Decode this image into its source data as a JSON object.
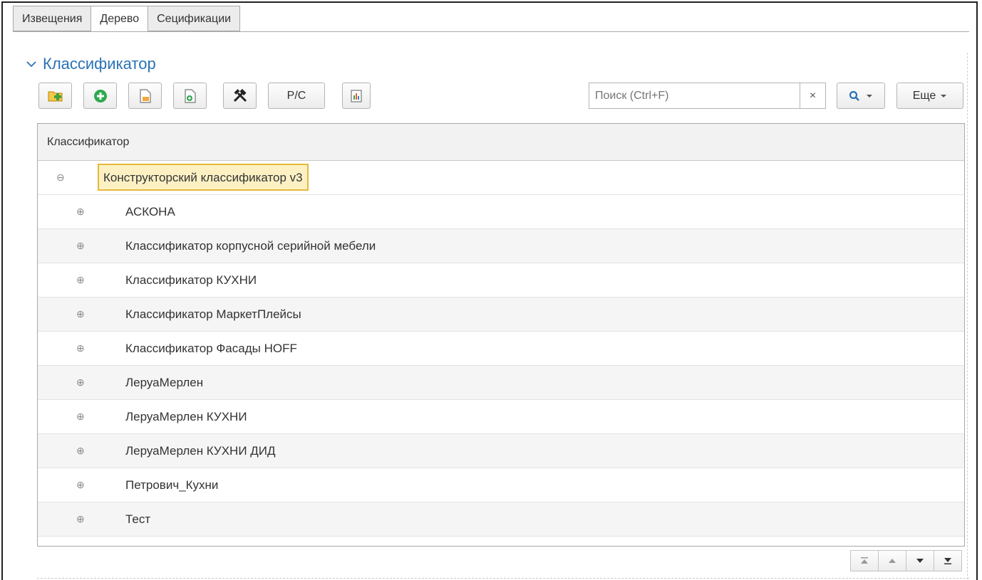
{
  "tabs": [
    {
      "label": "Извещения"
    },
    {
      "label": "Дерево",
      "active": true
    },
    {
      "label": "Сецификации"
    }
  ],
  "group": {
    "title": "Классификатор"
  },
  "toolbar": {
    "buttons": [
      {
        "icon": "folder-add-icon"
      },
      {
        "icon": "add-circle-icon"
      },
      {
        "icon": "document-edit-icon"
      },
      {
        "icon": "document-copy-icon"
      },
      {
        "icon": "tools-icon"
      },
      {
        "label": "Р/С"
      },
      {
        "icon": "report-icon"
      }
    ],
    "search_placeholder": "Поиск (Ctrl+F)",
    "search_clear": "×",
    "more_label": "Еще"
  },
  "table": {
    "header": "Классификатор",
    "root": "Конструкторский классификатор v3",
    "rows": [
      "АСКОНА",
      "Классификатор корпусной серийной мебели",
      "Классификатор КУХНИ",
      "Классификатор МаркетПлейсы",
      "Классификатор Фасады HOFF",
      "ЛеруаМерлен",
      "ЛеруаМерлен КУХНИ",
      "ЛеруаМерлен КУХНИ ДИД",
      "Петрович_Кухни",
      "Тест"
    ]
  },
  "colors": {
    "accent": "#2b73b5",
    "selection_fill": "#fdf1c4",
    "selection_border": "#e5b83a"
  }
}
